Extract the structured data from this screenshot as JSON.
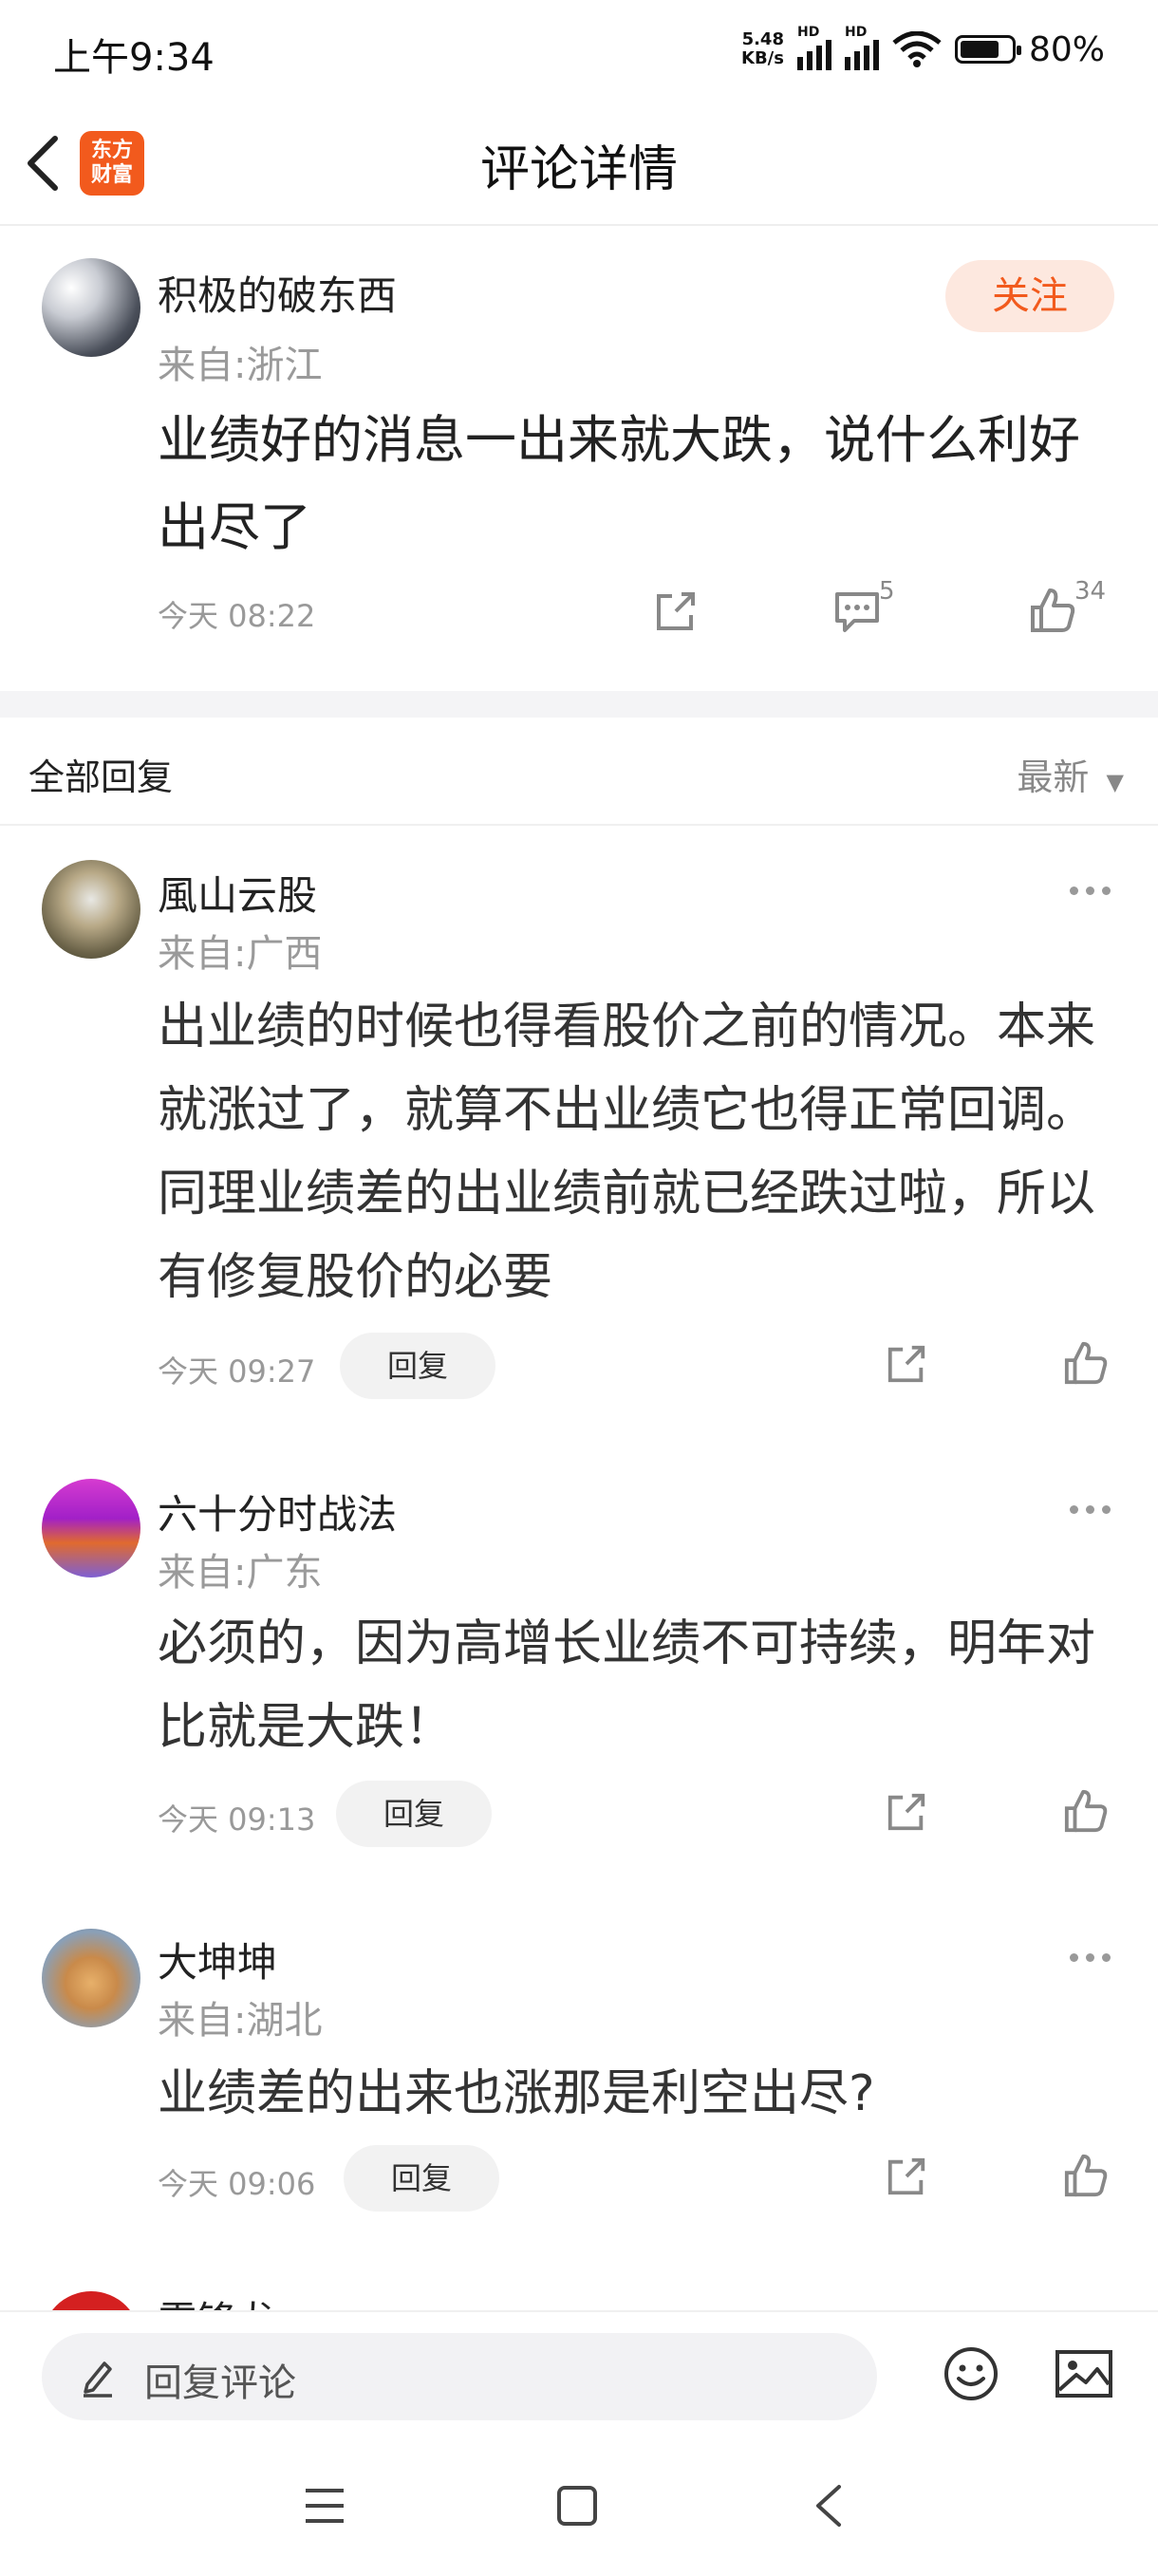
{
  "status": {
    "time": "上午9:34",
    "speed_top": "5.48",
    "speed_bottom": "KB/s",
    "hd": "HD",
    "battery": "80%",
    "battery_level": 0.8
  },
  "header": {
    "title": "评论详情",
    "logo_line1": "东方",
    "logo_line2": "财富"
  },
  "post": {
    "username": "积极的破东西",
    "location": "来自:浙江",
    "follow_label": "关注",
    "text": "业绩好的消息一出来就大跌，说什么利好出尽了",
    "time": "今天 08:22",
    "comment_count": "5",
    "like_count": "34"
  },
  "section": {
    "title": "全部回复",
    "sort": "最新"
  },
  "replies": [
    {
      "username": "風山云股",
      "location": "来自:广西",
      "text": "出业绩的时候也得看股价之前的情况。本来就涨过了，就算不出业绩它也得正常回调。同理业绩差的出业绩前就已经跌过啦，所以有修复股价的必要",
      "time": "今天 09:27",
      "reply_label": "回复"
    },
    {
      "username": "六十分时战法",
      "location": "来自:广东",
      "text": "必须的，因为高增长业绩不可持续，明年对比就是大跌！",
      "time": "今天 09:13",
      "reply_label": "回复"
    },
    {
      "username": "大坤坤",
      "location": "来自:湖北",
      "text": "业绩差的出来也涨那是利空出尽?",
      "time": "今天 09:06",
      "reply_label": "回复"
    },
    {
      "username": "雷锋龙"
    }
  ],
  "bottom": {
    "placeholder": "回复评论"
  },
  "colors": {
    "brand": "#f25a1d",
    "follow_bg": "#fde8df"
  }
}
